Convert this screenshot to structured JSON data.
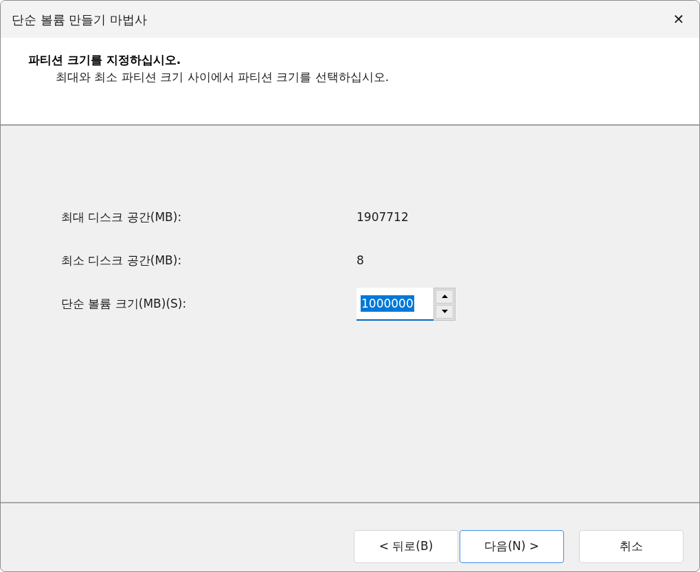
{
  "window": {
    "title": "단순 볼륨 만들기 마법사",
    "close": "✕"
  },
  "header": {
    "title": "파티션 크기를 지정하십시오.",
    "subtitle": "최대와 최소 파티션 크기 사이에서 파티션 크기를 선택하십시오."
  },
  "fields": [
    {
      "kind": "readout",
      "label": "최대 디스크 공간(MB):",
      "value": "1907712"
    },
    {
      "kind": "readout",
      "label": "최소 디스크 공간(MB):",
      "value": "8"
    },
    {
      "kind": "spinner",
      "label": "단순 볼륨 크기(MB)(S):",
      "value": "1000000",
      "text_selected": true
    }
  ],
  "buttons": [
    {
      "label": "< 뒤로(B)",
      "default": false
    },
    {
      "label": "다음(N) >",
      "default": true
    },
    {
      "label": "취소",
      "default": false
    }
  ]
}
